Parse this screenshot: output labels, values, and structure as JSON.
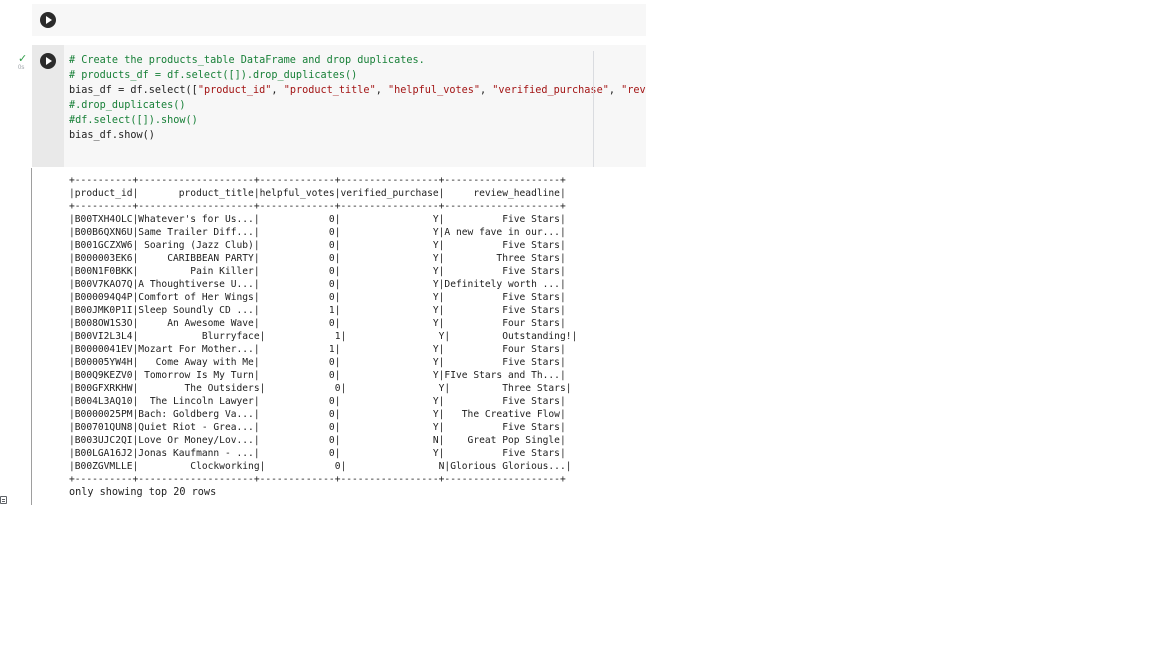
{
  "cells": [
    {
      "type": "code",
      "state": "empty",
      "run_icon": "play-circle-icon"
    },
    {
      "type": "code",
      "state": "executed",
      "run_icon": "play-circle-icon",
      "status_icon": "check-icon",
      "status_color": "#2e9d48",
      "exec_time": "0s",
      "code_lines": [
        {
          "kind": "comment",
          "text": "# Create the products_table DataFrame and drop duplicates."
        },
        {
          "kind": "comment",
          "text": "# products_df = df.select([]).drop_duplicates()"
        },
        {
          "kind": "code_with_strings",
          "text": "bias_df = df.select([\"product_id\", \"product_title\", \"helpful_votes\", \"verified_purchase\", \"review_headline\"])"
        },
        {
          "kind": "comment",
          "text": "#.drop_duplicates()"
        },
        {
          "kind": "comment",
          "text": "#df.select([]).show()"
        },
        {
          "kind": "code",
          "text": "bias_df.show()"
        }
      ],
      "output": {
        "table_border": "+----------+--------------------+-------------+-----------------+--------------------+",
        "table_header": "|product_id|       product_title|helpful_votes|verified_purchase|     review_headline|",
        "table_rows": [
          "|B00TXH4OLC|Whatever's for Us...|            0|                Y|          Five Stars|",
          "|B00B6QXN6U|Same Trailer Diff...|            0|                Y|A new fave in our...|",
          "|B001GCZXW6| Soaring (Jazz Club)|            0|                Y|          Five Stars|",
          "|B000003EK6|     CARIBBEAN PARTY|            0|                Y|         Three Stars|",
          "|B00N1F0BKK|         Pain Killer|            0|                Y|          Five Stars|",
          "|B00V7KAO7Q|A Thoughtiverse U...|            0|                Y|Definitely worth ...|",
          "|B000094Q4P|Comfort of Her Wings|            0|                Y|          Five Stars|",
          "|B00JMK0P1I|Sleep Soundly CD ...|            1|                Y|          Five Stars|",
          "|B008OW1S3O|     An Awesome Wave|            0|                Y|          Four Stars|",
          "|B00VI2L3L4|           Blurryface|            1|                Y|         Outstanding!|",
          "|B0000041EV|Mozart For Mother...|            1|                Y|          Four Stars|",
          "|B00005YW4H|   Come Away with Me|            0|                Y|          Five Stars|",
          "|B00Q9KEZV0| Tomorrow Is My Turn|            0|                Y|FIve Stars and Th...|",
          "|B00GFXRKHW|        The Outsiders|            0|                Y|         Three Stars|",
          "|B004L3AQ10|  The Lincoln Lawyer|            0|                Y|          Five Stars|",
          "|B0000025PM|Bach: Goldberg Va...|            0|                Y|   The Creative Flow|",
          "|B00701QUN8|Quiet Riot - Grea...|            0|                Y|          Five Stars|",
          "|B003UJC2QI|Love Or Money/Lov...|            0|                N|    Great Pop Single|",
          "|B00LGA16J2|Jonas Kaufmann - ...|            0|                Y|          Five Stars|",
          "|B00ZGVMLLE|         Clockworking|            0|                N|Glorious Glorious...|"
        ],
        "footer": "only showing top 20 rows"
      }
    }
  ],
  "sidebar_icon": "table-view-icon"
}
